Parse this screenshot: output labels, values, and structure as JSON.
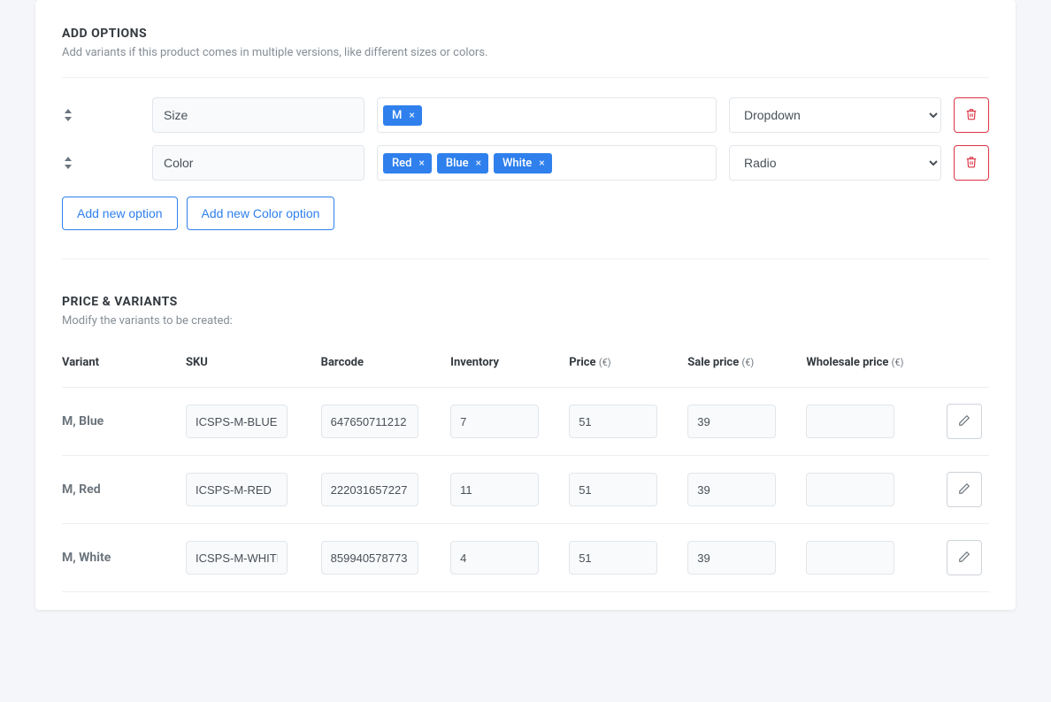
{
  "addOptions": {
    "title": "ADD OPTIONS",
    "subtitle": "Add variants if this product comes in multiple versions, like different sizes or colors.",
    "options": [
      {
        "name": "Size",
        "values": [
          "M"
        ],
        "type": "Dropdown"
      },
      {
        "name": "Color",
        "values": [
          "Red",
          "Blue",
          "White"
        ],
        "type": "Radio"
      }
    ],
    "typeChoices": [
      "Dropdown",
      "Radio"
    ],
    "addNewLabel": "Add new option",
    "addNewColorLabel": "Add new Color option"
  },
  "priceVariants": {
    "title": "PRICE & VARIANTS",
    "subtitle": "Modify the variants to be created:",
    "currency": "€",
    "columns": {
      "variant": "Variant",
      "sku": "SKU",
      "barcode": "Barcode",
      "inventory": "Inventory",
      "price": "Price",
      "salePrice": "Sale price",
      "wholesalePrice": "Wholesale price"
    },
    "rows": [
      {
        "variant": "M, Blue",
        "sku": "ICSPS-M-BLUE",
        "barcode": "647650711212",
        "inventory": "7",
        "price": "51",
        "salePrice": "39",
        "wholesalePrice": ""
      },
      {
        "variant": "M, Red",
        "sku": "ICSPS-M-RED",
        "barcode": "222031657227",
        "inventory": "11",
        "price": "51",
        "salePrice": "39",
        "wholesalePrice": ""
      },
      {
        "variant": "M, White",
        "sku": "ICSPS-M-WHITE",
        "barcode": "859940578773",
        "inventory": "4",
        "price": "51",
        "salePrice": "39",
        "wholesalePrice": ""
      }
    ]
  }
}
